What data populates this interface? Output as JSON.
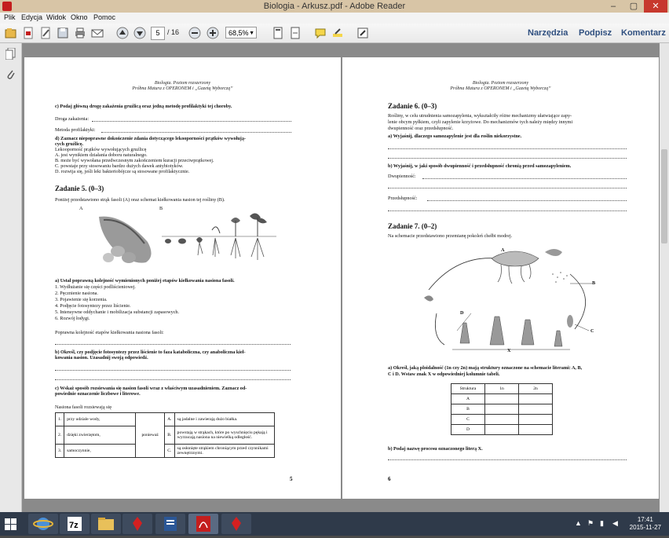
{
  "window": {
    "title": "Biologia - Arkusz.pdf - Adobe Reader",
    "min": "–",
    "max": "▢",
    "close": "✕"
  },
  "menu": [
    "Plik",
    "Edycja",
    "Widok",
    "Okno",
    "Pomoc"
  ],
  "toolbar": {
    "page_current": "5",
    "page_total": "/ 16",
    "zoom": "68,5%",
    "tools": "Narzędzia",
    "sign": "Podpisz",
    "comment": "Komentarz"
  },
  "left_page": {
    "header1": "Biologia. Poziom rozszerzony",
    "header2": "Próbna Matura z OPERONEM i „Gazetą Wyborczą”",
    "c_question": "c) Podaj główną drogę zakażenia gruźlicą oraz jedną metodę profilaktyki tej choroby.",
    "droga": "Droga zakażenia:",
    "metoda": "Metoda profilaktyki:",
    "d_question1": "d) Zaznacz niepoprawne dokończenie zdania dotyczącego lekooporności prątków wywołują-",
    "d_question2": "cych gruźlicę.",
    "d_lead": "Lekooporność prątków wywołujących gruźlicę",
    "d_options": [
      "A. jest wynikiem działania doboru naturalnego.",
      "B. może być wywołana przedwczesnym zakończeniem kuracji przeciwprątkowej.",
      "C. powstaje przy stosowaniu bardzo dużych dawek antybiotyków.",
      "D. rozwija się, jeśli leki bakteriobójcze są stosowane profilaktycznie."
    ],
    "task_title": "Zadanie 5. (0–3)",
    "task_intro": "Poniżej przedstawiono strąk fasoli (A) oraz schemat kiełkowania nasion tej rośliny (B).",
    "label_a": "A",
    "label_b": "B",
    "a_question": "a) Ustal poprawną kolejność wymienionych poniżej etapów kiełkowania nasiona fasoli.",
    "a_steps": [
      "1. Wydłużanie się części podliścieniowej.",
      "2. Pęcznienie nasiona.",
      "3. Pojawienie się korzenia.",
      "4. Podjęcie fotosyntezy przez liścienie.",
      "5. Intensywne oddychanie i mobilizacja substancji zapasowych.",
      "6. Rozwój łodygi."
    ],
    "order_label": "Poprawna kolejność etapów kiełkowania nasiona fasoli:",
    "b_question1": "b) Określ, czy podjęcie fotosyntezy przez liścienie to faza kataboliczna, czy anaboliczna kieł-",
    "b_question2": "kowania nasion. Uzasadnij swoją odpowiedź.",
    "c2_question1": "c) Wskaż sposób rozsiewania się nasion fasoli wraz z właściwym uzasadnieniem. Zaznacz od-",
    "c2_question2": "powiednie oznaczenie liczbowe i literowe.",
    "seeds_lead": "Nasiona fasoli rozsiewają się",
    "table": {
      "because": "ponieważ",
      "rows": [
        {
          "n": "1.",
          "way": "przy udziale wody,",
          "l": "A.",
          "reason": "są jadalne i zawierają dużo białka."
        },
        {
          "n": "2.",
          "way": "dzięki zwierzętom,",
          "l": "B.",
          "reason": "powstają w strąkach, które po wyschnięciu pękają i wyrzucają nasiona na niewielką odległość."
        },
        {
          "n": "3.",
          "way": "samoczynnie,",
          "l": "C.",
          "reason": "są osłonięte strąkiem chroniącym przed czynnikami zewnętrznymi."
        }
      ]
    },
    "page_number": "5"
  },
  "right_page": {
    "header1": "Biologia. Poziom rozszerzony",
    "header2": "Próbna Matura z OPERONEM i „Gazetą Wyborczą”",
    "task6_title": "Zadanie 6. (0–3)",
    "task6_intro": [
      "Rośliny, w celu utrudnienia samozapylenia, wykształciły różne mechanizmy ułatwiające zapy-",
      "lenie obcym pyłkiem, czyli zapylenie krzyżowe. Do mechanizmów tych należy między innymi",
      "dwupienność oraz przedsłupność."
    ],
    "a_question": "a) Wyjaśnij, dlaczego samozapylenie jest dla roślin niekorzystne.",
    "b_question": "b) Wyjaśnij, w jaki sposób dwupienność i przedsłupność chronią przed samozapyleniem.",
    "dwupiennosc": "Dwupienność:",
    "przedslupnosc": "Przedsłupność:",
    "task7_title": "Zadanie 7. (0–2)",
    "task7_intro": "Na schemacie przedstawiono przemianę pokoleń chełbi modrej.",
    "diagram_labels": {
      "a": "A",
      "b": "B",
      "c": "C",
      "d": "D",
      "x": "X"
    },
    "a7_question1": "a) Określ, jaką ploidalność (1n czy 2n) mają struktury oznaczone na schemacie literami: A, B,",
    "a7_question2": "C i D. Wstaw znak X w odpowiedniej kolumnie tabeli.",
    "table": {
      "headers": [
        "Struktura",
        "1n",
        "2n"
      ],
      "rows": [
        "A",
        "B",
        "C",
        "D"
      ]
    },
    "b7_question": "b) Podaj nazwę procesu oznaczonego literą X.",
    "page_number": "6"
  },
  "taskbar": {
    "time": "17:41",
    "date": "2015-11-27"
  }
}
